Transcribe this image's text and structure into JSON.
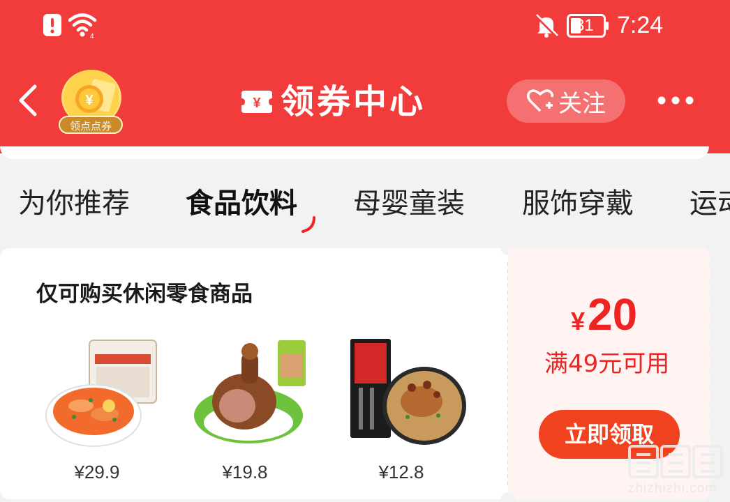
{
  "status_bar": {
    "time": "7:24",
    "battery_level": "31",
    "icons": [
      "alert-icon",
      "wifi-icon",
      "mute-bell-icon",
      "battery-icon"
    ]
  },
  "header": {
    "title": "领券中心",
    "points_badge_label": "领点点券",
    "follow_label": "关注",
    "icons": [
      "back-chevron-icon",
      "coupon-yuan-icon",
      "heart-plus-icon",
      "more-dots-icon"
    ]
  },
  "tabs": [
    {
      "label": "为你推荐",
      "active": false
    },
    {
      "label": "食品饮料",
      "active": true
    },
    {
      "label": "母婴童装",
      "active": false
    },
    {
      "label": "服饰穿戴",
      "active": false
    },
    {
      "label": "运动",
      "active": false
    }
  ],
  "coupon_card": {
    "restriction": "仅可购买休闲零食商品",
    "products": [
      {
        "price": "¥29.9",
        "image": "fried-snack-plate"
      },
      {
        "price": "¥19.8",
        "image": "braised-chicken-drumstick"
      },
      {
        "price": "¥12.8",
        "image": "noodle-bowl-box"
      }
    ],
    "currency": "¥",
    "amount": "20",
    "condition": "满49元可用",
    "claim_label": "立即领取"
  },
  "watermark": {
    "logo_text": "值值值",
    "site": "zhizhizhi.com"
  },
  "colors": {
    "header_red": "#f23b3b",
    "accent_red": "#ee2323",
    "button_red": "#f0421e",
    "coupon_bg": "#fff4f2"
  }
}
